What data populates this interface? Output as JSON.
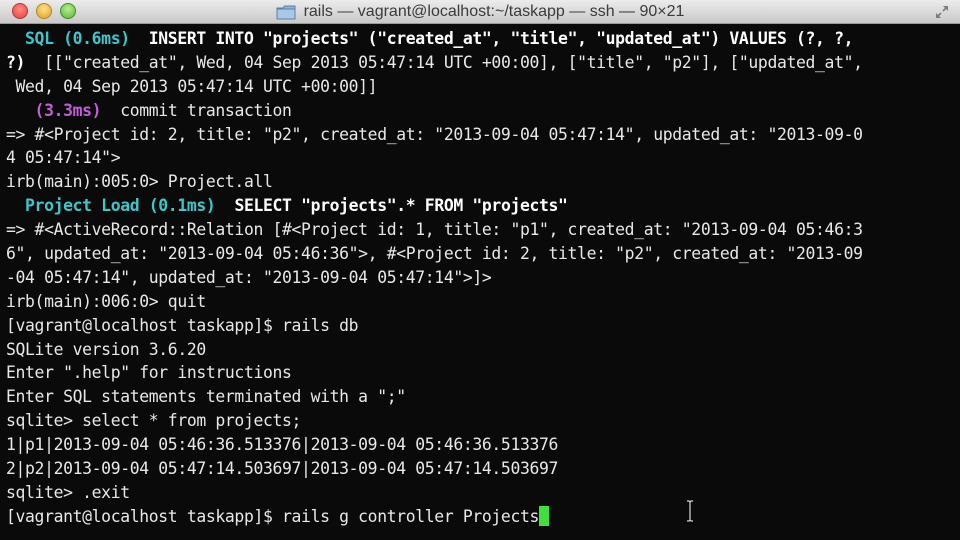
{
  "window": {
    "title": "rails — vagrant@localhost:~/taskapp — ssh — 90×21",
    "icons": {
      "close": "close-button",
      "minimize": "minimize-button",
      "zoom": "zoom-button",
      "folder": "folder-icon",
      "fullscreen": "fullscreen-icon"
    }
  },
  "terminal": {
    "cursor_color": "#3ee03e",
    "lines": [
      {
        "id": "l1",
        "segments": [
          {
            "text": "  SQL (0.6ms)",
            "style": "cyan"
          },
          {
            "text": "  INSERT INTO \"projects\" (\"created_at\", \"title\", \"updated_at\") VALUES (?, ?,",
            "style": "bold"
          }
        ]
      },
      {
        "id": "l2",
        "segments": [
          {
            "text": "?)",
            "style": "bold"
          },
          {
            "text": "  [[\"created_at\", Wed, 04 Sep 2013 05:47:14 UTC +00:00], [\"title\", \"p2\"], [\"updated_at\",",
            "style": "plain"
          }
        ]
      },
      {
        "id": "l3",
        "segments": [
          {
            "text": " Wed, 04 Sep 2013 05:47:14 UTC +00:00]]",
            "style": "plain"
          }
        ]
      },
      {
        "id": "l4",
        "segments": [
          {
            "text": "   (3.3ms)",
            "style": "magenta"
          },
          {
            "text": "  commit transaction",
            "style": "plain"
          }
        ]
      },
      {
        "id": "l5",
        "segments": [
          {
            "text": "=> #<Project id: 2, title: \"p2\", created_at: \"2013-09-04 05:47:14\", updated_at: \"2013-09-0",
            "style": "plain"
          }
        ]
      },
      {
        "id": "l6",
        "segments": [
          {
            "text": "4 05:47:14\">",
            "style": "plain"
          }
        ]
      },
      {
        "id": "l7",
        "segments": [
          {
            "text": "irb(main):005:0> Project.all",
            "style": "plain"
          }
        ]
      },
      {
        "id": "l8",
        "segments": [
          {
            "text": "  Project Load (0.1ms)",
            "style": "cyan"
          },
          {
            "text": "  SELECT \"projects\".* FROM \"projects\"",
            "style": "bold"
          }
        ]
      },
      {
        "id": "l9",
        "segments": [
          {
            "text": "=> #<ActiveRecord::Relation [#<Project id: 1, title: \"p1\", created_at: \"2013-09-04 05:46:3",
            "style": "plain"
          }
        ]
      },
      {
        "id": "l10",
        "segments": [
          {
            "text": "6\", updated_at: \"2013-09-04 05:46:36\">, #<Project id: 2, title: \"p2\", created_at: \"2013-09",
            "style": "plain"
          }
        ]
      },
      {
        "id": "l11",
        "segments": [
          {
            "text": "-04 05:47:14\", updated_at: \"2013-09-04 05:47:14\">]>",
            "style": "plain"
          }
        ]
      },
      {
        "id": "l12",
        "segments": [
          {
            "text": "irb(main):006:0> quit",
            "style": "plain"
          }
        ]
      },
      {
        "id": "l13",
        "segments": [
          {
            "text": "[vagrant@localhost taskapp]$ rails db",
            "style": "plain"
          }
        ]
      },
      {
        "id": "l14",
        "segments": [
          {
            "text": "SQLite version 3.6.20",
            "style": "plain"
          }
        ]
      },
      {
        "id": "l15",
        "segments": [
          {
            "text": "Enter \".help\" for instructions",
            "style": "plain"
          }
        ]
      },
      {
        "id": "l16",
        "segments": [
          {
            "text": "Enter SQL statements terminated with a \";\"",
            "style": "plain"
          }
        ]
      },
      {
        "id": "l17",
        "segments": [
          {
            "text": "sqlite> select * from projects;",
            "style": "plain"
          }
        ]
      },
      {
        "id": "l18",
        "segments": [
          {
            "text": "1|p1|2013-09-04 05:46:36.513376|2013-09-04 05:46:36.513376",
            "style": "plain"
          }
        ]
      },
      {
        "id": "l19",
        "segments": [
          {
            "text": "2|p2|2013-09-04 05:47:14.503697|2013-09-04 05:47:14.503697",
            "style": "plain"
          }
        ]
      },
      {
        "id": "l20",
        "segments": [
          {
            "text": "sqlite> .exit",
            "style": "plain"
          }
        ]
      },
      {
        "id": "l21",
        "segments": [
          {
            "text": "[vagrant@localhost taskapp]$ rails g controller Projects",
            "style": "plain"
          }
        ],
        "cursor": true
      }
    ]
  }
}
